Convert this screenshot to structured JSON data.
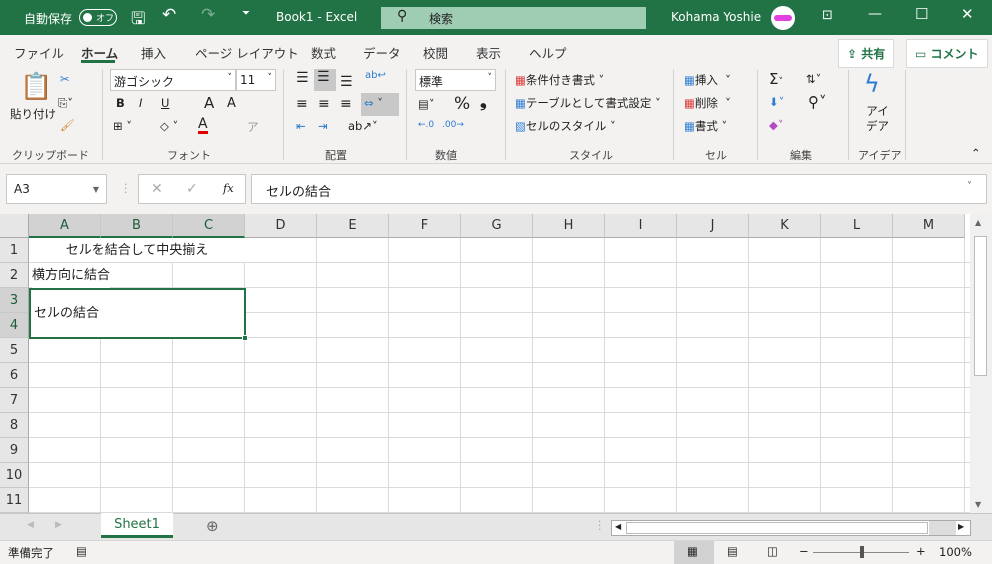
{
  "titlebar": {
    "autosave": "自動保存",
    "autosave_state": "オフ",
    "doc_title": "Book1  -  Excel",
    "search_placeholder": "検索",
    "user": "Kohama Yoshie",
    "bg": "#217346"
  },
  "menu_tabs": [
    "ファイル",
    "ホーム",
    "挿入",
    "ページ レイアウト",
    "数式",
    "データ",
    "校閲",
    "表示",
    "ヘルプ"
  ],
  "active_tab": "ホーム",
  "share": "共有",
  "comment": "コメント",
  "ribbon": {
    "clipboard": {
      "paste": "貼り付け",
      "label": "クリップボード"
    },
    "font": {
      "name": "游ゴシック",
      "size": "11",
      "bold": "B",
      "italic": "I",
      "underline": "U",
      "grow": "A",
      "shrink": "A",
      "color": "A",
      "phonetic": "ア",
      "label": "フォント"
    },
    "alignment": {
      "label": "配置"
    },
    "number": {
      "format": "標準",
      "percent": "%",
      "comma": "❟",
      "label": "数値"
    },
    "styles": {
      "conditional": "条件付き書式",
      "table": "テーブルとして書式設定",
      "cell_styles": "セルのスタイル",
      "label": "スタイル"
    },
    "cells": {
      "insert": "挿入",
      "delete": "削除",
      "format": "書式",
      "label": "セル"
    },
    "editing": {
      "sum": "Σ",
      "label": "編集"
    },
    "ideas": {
      "button": "アイ\nデア",
      "label": "アイデア"
    }
  },
  "formula_bar": {
    "name_box": "A3",
    "fx": "fx",
    "content": "セルの結合"
  },
  "columns": [
    "A",
    "B",
    "C",
    "D",
    "E",
    "F",
    "G",
    "H",
    "I",
    "J",
    "K",
    "L",
    "M"
  ],
  "rows": [
    "1",
    "2",
    "3",
    "4",
    "5",
    "6",
    "7",
    "8",
    "9",
    "10",
    "11"
  ],
  "cells": {
    "A1": "セルを結合して中央揃え",
    "A2": "横方向に結合",
    "A3": "セルの結合"
  },
  "sheet_tabs": [
    "Sheet1"
  ],
  "status": {
    "ready": "準備完了",
    "zoom": "100%",
    "zoom_minus": "−",
    "zoom_plus": "+"
  }
}
